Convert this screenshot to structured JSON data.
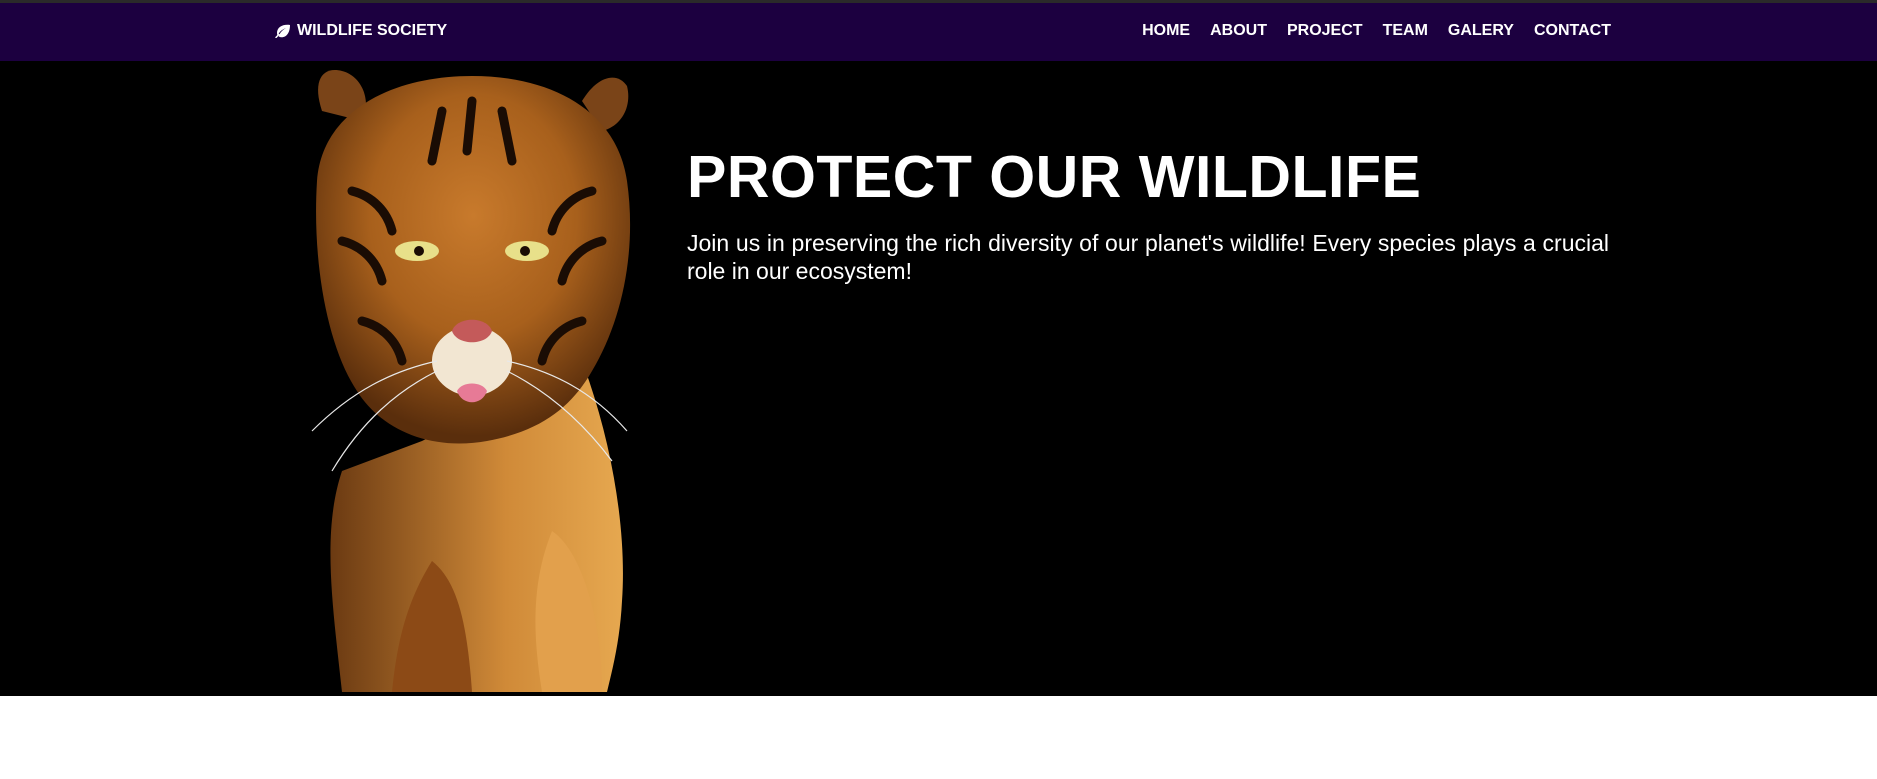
{
  "navbar": {
    "brand_icon": "leaf-icon",
    "brand": "WILDLIFE SOCIETY",
    "links": [
      {
        "label": "HOME"
      },
      {
        "label": "ABOUT"
      },
      {
        "label": "PROJECT"
      },
      {
        "label": "TEAM"
      },
      {
        "label": "GALERY"
      },
      {
        "label": "CONTACT"
      }
    ],
    "background_color": "#1c0040"
  },
  "hero": {
    "image": "tiger-image",
    "title": "PROTECT OUR WILDLIFE",
    "text": "Join us in preserving the rich diversity of our planet's wildlife! Every species plays a crucial role in our ecosystem!",
    "background_color": "#000000"
  }
}
